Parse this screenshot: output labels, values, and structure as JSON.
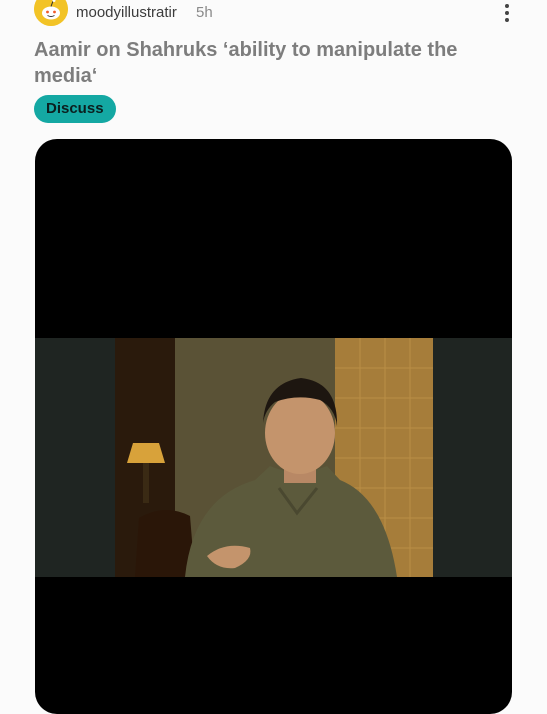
{
  "post": {
    "username": "moodyillustratir",
    "time": "5h",
    "title": "Aamir on Shahruks ‘ability to manipulate the media‘",
    "flair": "Discuss"
  },
  "icons": {
    "avatar": "reddit-snoo-avatar",
    "more": "vertical-ellipsis-icon"
  },
  "colors": {
    "flair_background": "#14a8a3",
    "avatar_background": "#f2c326",
    "video_background": "#000000"
  }
}
